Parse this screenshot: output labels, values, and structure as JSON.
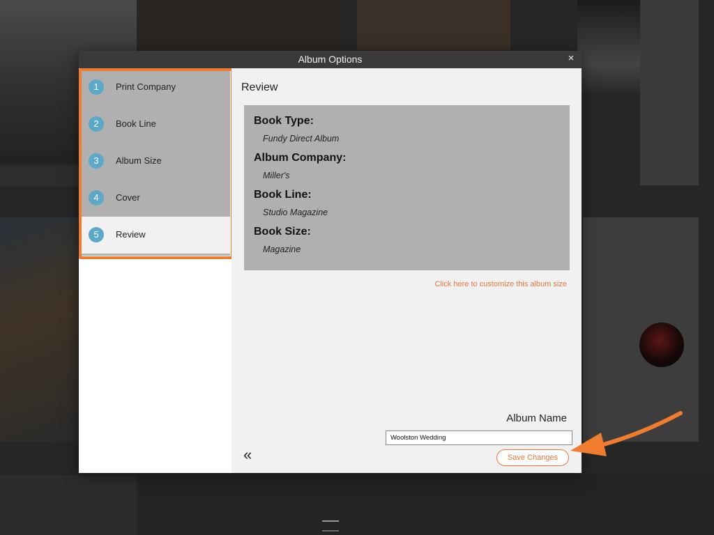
{
  "window": {
    "title": "Album Options",
    "close_glyph": "×"
  },
  "sidebar": {
    "steps": [
      {
        "number": "1",
        "label": "Print Company"
      },
      {
        "number": "2",
        "label": "Book Line"
      },
      {
        "number": "3",
        "label": "Album Size"
      },
      {
        "number": "4",
        "label": "Cover"
      },
      {
        "number": "5",
        "label": "Review"
      }
    ],
    "active_step": 5
  },
  "review": {
    "heading": "Review",
    "fields": [
      {
        "label": "Book Type:",
        "value": "Fundy Direct Album"
      },
      {
        "label": "Album Company:",
        "value": "Miller's"
      },
      {
        "label": "Book Line:",
        "value": "Studio Magazine"
      },
      {
        "label": "Book Size:",
        "value": "Magazine"
      }
    ],
    "customize_link": "Click here to customize this album size",
    "album_name_label": "Album Name",
    "album_name_value": "Woolston Wedding",
    "back_glyph": "«",
    "save_label": "Save Changes"
  },
  "colors": {
    "accent": "#e8743b",
    "highlight_border": "#f07c30",
    "step_badge": "#5ba8c9",
    "titlebar": "#3a3a3a"
  },
  "icons": {
    "close": "close-icon",
    "back": "double-chevron-left-icon"
  }
}
